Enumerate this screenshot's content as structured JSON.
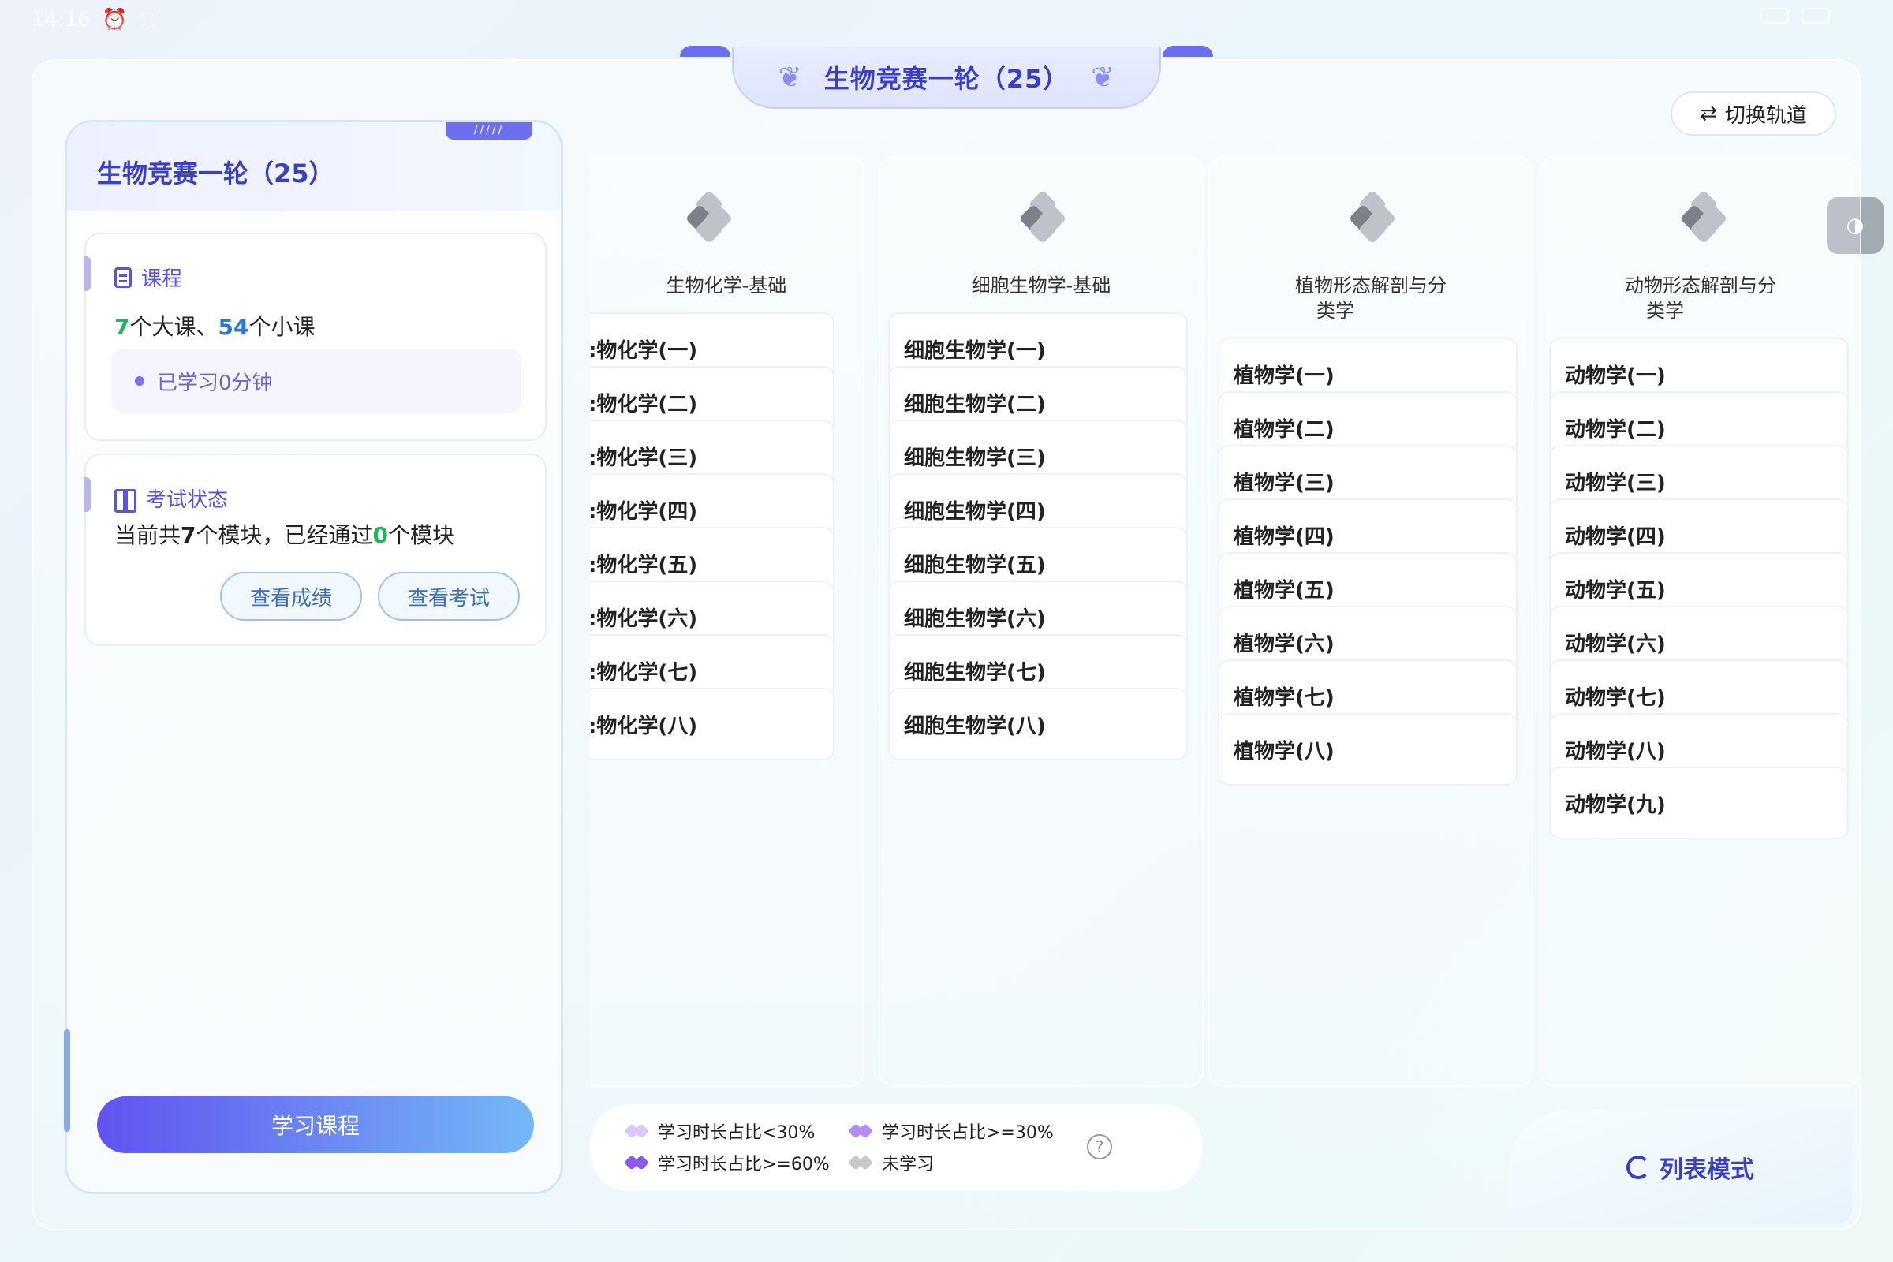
{
  "status": {
    "time": "14:16"
  },
  "header": {
    "title": "生物竞赛一轮（25）",
    "switch_label": "切换轨道",
    "toggle_glyph": "◑"
  },
  "left_panel": {
    "title": "生物竞赛一轮（25）",
    "stripe": "/////",
    "course_card": {
      "title": "课程",
      "major_count": "7",
      "major_text": "个大课、",
      "minor_count": "54",
      "minor_text": "个小课",
      "studied": "已学习0分钟"
    },
    "exam_card": {
      "title": "考试状态",
      "text_prefix": "当前共",
      "module_count": "7",
      "text_mid": "个模块，已经通过",
      "passed_count": "0",
      "text_suffix": "个模块",
      "view_scores": "查看成绩",
      "view_exams": "查看考试"
    },
    "study_button": "学习课程"
  },
  "columns": [
    {
      "name": "生物化学-基础",
      "lessons": [
        ":物化学(一)",
        ":物化学(二)",
        ":物化学(三)",
        ":物化学(四)",
        ":物化学(五)",
        ":物化学(六)",
        ":物化学(七)",
        ":物化学(八)"
      ]
    },
    {
      "name": "细胞生物学-基础",
      "lessons": [
        "细胞生物学(一)",
        "细胞生物学(二)",
        "细胞生物学(三)",
        "细胞生物学(四)",
        "细胞生物学(五)",
        "细胞生物学(六)",
        "细胞生物学(七)",
        "细胞生物学(八)"
      ]
    },
    {
      "name_line1": "植物形态解剖与分",
      "name_line2": "类学",
      "lessons": [
        "植物学(一)",
        "植物学(二)",
        "植物学(三)",
        "植物学(四)",
        "植物学(五)",
        "植物学(六)",
        "植物学(七)",
        "植物学(八)"
      ]
    },
    {
      "name_line1": "动物形态解剖与分",
      "name_line2": "类学",
      "lessons": [
        "动物学(一)",
        "动物学(二)",
        "动物学(三)",
        "动物学(四)",
        "动物学(五)",
        "动物学(六)",
        "动物学(七)",
        "动物学(八)",
        "动物学(九)"
      ]
    }
  ],
  "legend": {
    "lt30": "学习时长占比<30%",
    "ge30": "学习时长占比>=30%",
    "ge60": "学习时长占比>=60%",
    "none": "未学习",
    "help": "?"
  },
  "list_mode": "列表模式",
  "colors": {
    "accent": "#3b3fc4",
    "green": "#1db45a",
    "blue": "#2b77d8",
    "button_start": "#6153f0",
    "button_end": "#74b8f7"
  }
}
